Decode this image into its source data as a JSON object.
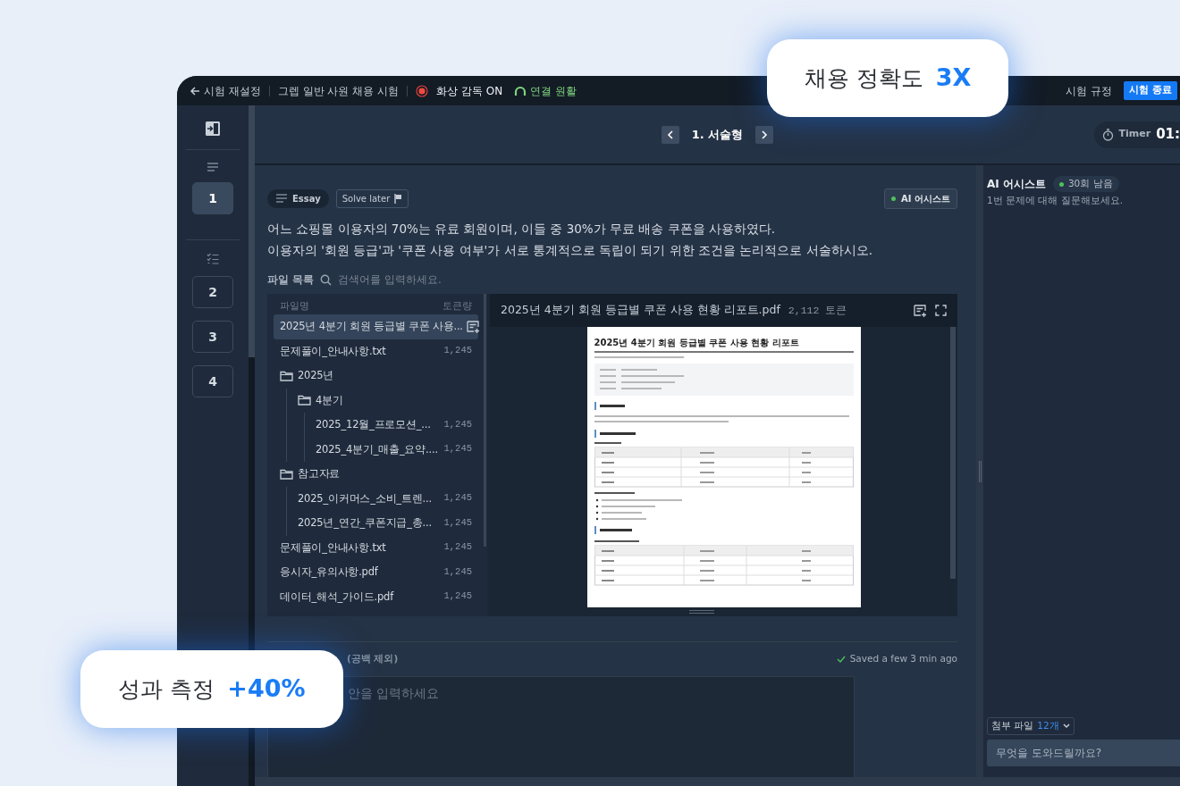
{
  "top_bar": {
    "back": "시험 재설정",
    "exam_title": "그렙 일반 사원 채용 시험",
    "proctoring": "화상 감독 ON",
    "connection": "연결 원활",
    "rules": "시험 규정",
    "end_button": "시험 종료"
  },
  "question_rail": [
    {
      "kind": "essay",
      "questions": [
        {
          "label": "1",
          "selected": true
        }
      ]
    },
    {
      "kind": "choice",
      "questions": [
        {
          "label": "2",
          "selected": false
        },
        {
          "label": "3",
          "selected": false
        },
        {
          "label": "4",
          "selected": false
        }
      ]
    }
  ],
  "question_nav": {
    "label": "1. 서술형"
  },
  "timer": {
    "label": "Timer",
    "value": "01:"
  },
  "question": {
    "type_chip": "Essay",
    "solve_later": "Solve later",
    "ai_chip": "AI 어시스트",
    "lines": [
      "어느 쇼핑몰 이용자의 70%는 유료 회원이며, 이들 중 30%가 무료 배송 쿠폰을 사용하였다.",
      "이용자의 '회원 등급'과 '쿠폰 사용 여부'가 서로 통계적으로 독립이 되기 위한 조건을 논리적으로 서술하시오."
    ]
  },
  "files": {
    "title": "파일 목록",
    "search": {
      "placeholder": "검색어를 입력하세요."
    },
    "columns": [
      "파일명",
      "토큰량"
    ],
    "items": [
      {
        "kind": "file",
        "name": "2025년 4분기 회원 등급별 쿠폰 사용...",
        "selected": true
      },
      {
        "kind": "file",
        "name": "문제풀이_안내사항.txt",
        "tokens": "1,245",
        "selected": false
      },
      {
        "kind": "folder",
        "name": "2025년",
        "children": [
          {
            "kind": "folder",
            "name": "4분기",
            "children": [
              {
                "kind": "file",
                "name": "2025_12월_프로모션_...",
                "tokens": "1,245",
                "selected": false
              },
              {
                "kind": "file",
                "name": "2025_4분기_매출_요약....",
                "tokens": "1,245",
                "selected": false
              }
            ]
          }
        ]
      },
      {
        "kind": "folder",
        "name": "참고자료",
        "children": [
          {
            "kind": "file",
            "name": "2025_이커머스_소비_트렌...",
            "tokens": "1,245",
            "selected": false
          },
          {
            "kind": "file",
            "name": "2025년_연간_쿠폰지급_총...",
            "tokens": "1,245",
            "selected": false
          }
        ]
      },
      {
        "kind": "file",
        "name": "문제풀이_안내사항.txt",
        "tokens": "1,245",
        "selected": false
      },
      {
        "kind": "file",
        "name": "응시자_유의사항.pdf",
        "tokens": "1,245",
        "selected": false
      },
      {
        "kind": "file",
        "name": "데이터_해석_가이드.pdf",
        "tokens": "1,245",
        "selected": false
      }
    ]
  },
  "viewer": {
    "file_name": "2025년 4분기 회원 등급별 쿠폰 사용 현황 리포트.pdf",
    "tokens": "2,112 토큰",
    "document_title": "2025년 4분기 회원 등급별 쿠폰 사용 현황 리포트"
  },
  "answer": {
    "label": "(공백 제외)",
    "saved": "Saved a few 3 min ago",
    "placeholder": "안을 입력하세요"
  },
  "assistant": {
    "title": "AI 어시스트",
    "remaining": "30회 남음",
    "hint": "1번 문제에 대해 질문해보세요.",
    "attachments_label": "첨부 파일",
    "attachments_count": "12개",
    "input": {
      "placeholder": "무엇을 도와드릴까요?"
    }
  },
  "callouts": [
    {
      "label": "채용 정확도",
      "value": "3X"
    },
    {
      "label": "성과 측정",
      "value": "+40%"
    }
  ]
}
